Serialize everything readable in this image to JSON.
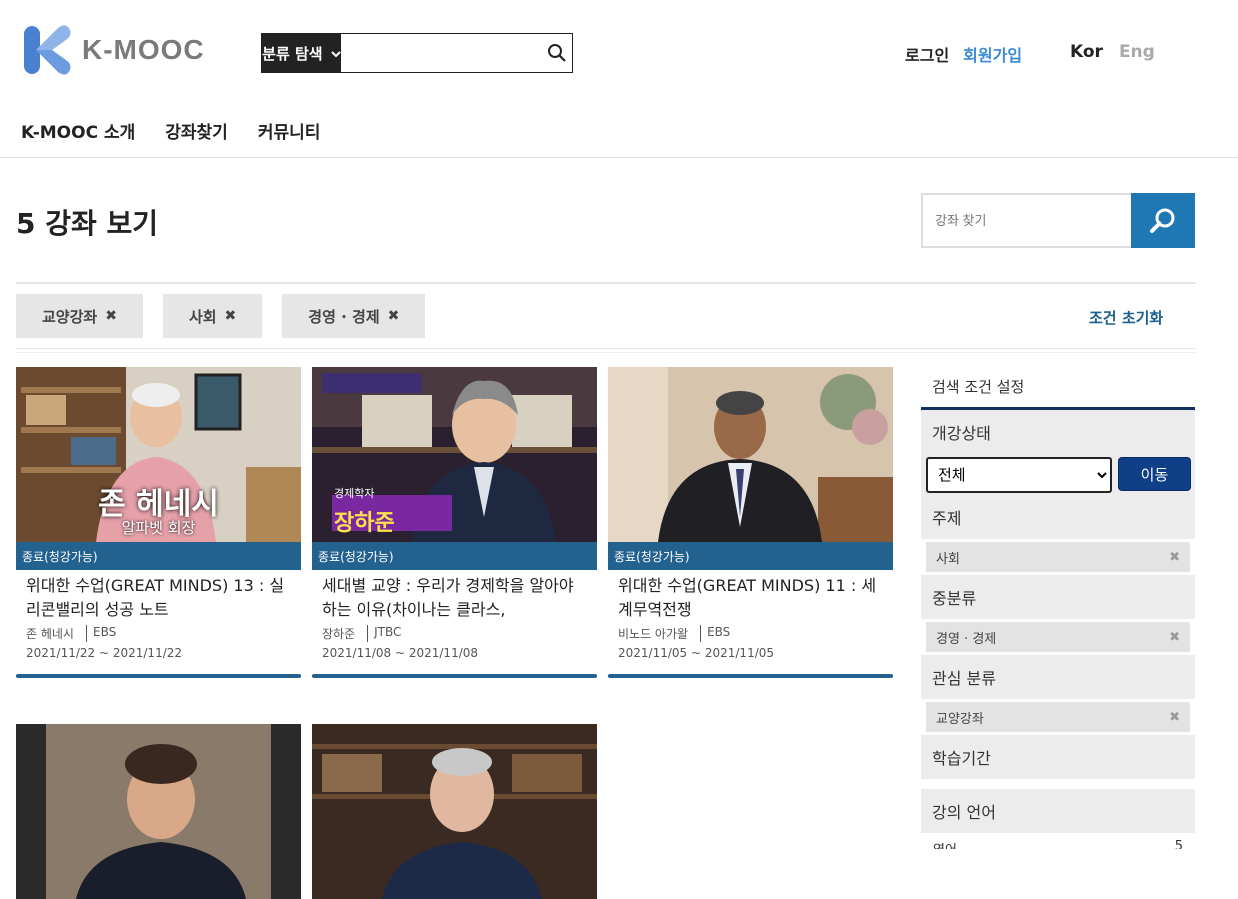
{
  "header": {
    "logo_text": "K-MOOC",
    "category_button": "분류 탐색",
    "category_search_placeholder": "",
    "login": "로그인",
    "signup": "회원가입",
    "lang_kor": "Kor",
    "lang_eng": "Eng",
    "colors": {
      "brand": "#5b8fd6",
      "signup": "#3a8ad8",
      "accent": "#1f78b4",
      "status": "#23628f"
    }
  },
  "nav": {
    "items": [
      {
        "label": "K-MOOC 소개"
      },
      {
        "label": "강좌찾기"
      },
      {
        "label": "커뮤니티"
      }
    ]
  },
  "main": {
    "title": "5 강좌 보기",
    "search_placeholder": "강좌 찾기",
    "chips": [
      {
        "label": "교양강좌"
      },
      {
        "label": "사회"
      },
      {
        "label": "경영 · 경제"
      }
    ],
    "chip_remove_glyph": "✖",
    "reset_label": "조건 초기화"
  },
  "courses": [
    {
      "status": "종료(청강가능)",
      "title": "위대한 수업(GREAT MINDS) 13 : 실리콘밸리의 성공 노트",
      "instructor": "존 헤네시",
      "org": "EBS",
      "dates": "2021/11/22 ~ 2021/11/22",
      "thumb_caption": "존 헤네시",
      "thumb_subcaption": "알파벳 회장"
    },
    {
      "status": "종료(청강가능)",
      "title": "세대별 교양 : 우리가 경제학을 알아야하는 이유(차이나는 클라스,",
      "instructor": "장하준",
      "org": "JTBC",
      "dates": "2021/11/08 ~ 2021/11/08",
      "thumb_caption": "장하준",
      "thumb_subcaption": "경제학자"
    },
    {
      "status": "종료(청강가능)",
      "title": "위대한 수업(GREAT MINDS) 11 : 세계무역전쟁",
      "instructor": "비노드 아가왈",
      "org": "EBS",
      "dates": "2021/11/05 ~ 2021/11/05",
      "thumb_caption": "",
      "thumb_subcaption": ""
    },
    {
      "status": "",
      "title": "",
      "instructor": "",
      "org": "",
      "dates": "",
      "thumb_caption": "",
      "thumb_subcaption": ""
    },
    {
      "status": "",
      "title": "",
      "instructor": "",
      "org": "",
      "dates": "",
      "thumb_caption": "",
      "thumb_subcaption": ""
    }
  ],
  "sidebar": {
    "title": "검색 조건 설정",
    "status_label": "개강상태",
    "status_selected": "전체",
    "move_button": "이동",
    "topic_label": "주제",
    "topic_value": "사회",
    "subcategory_label": "중분류",
    "subcategory_value": "경영 · 경제",
    "interest_label": "관심 분류",
    "interest_value": "교양강좌",
    "period_label": "학습기간",
    "language_label": "강의 언어",
    "language_item": "영어",
    "language_count": "5"
  }
}
